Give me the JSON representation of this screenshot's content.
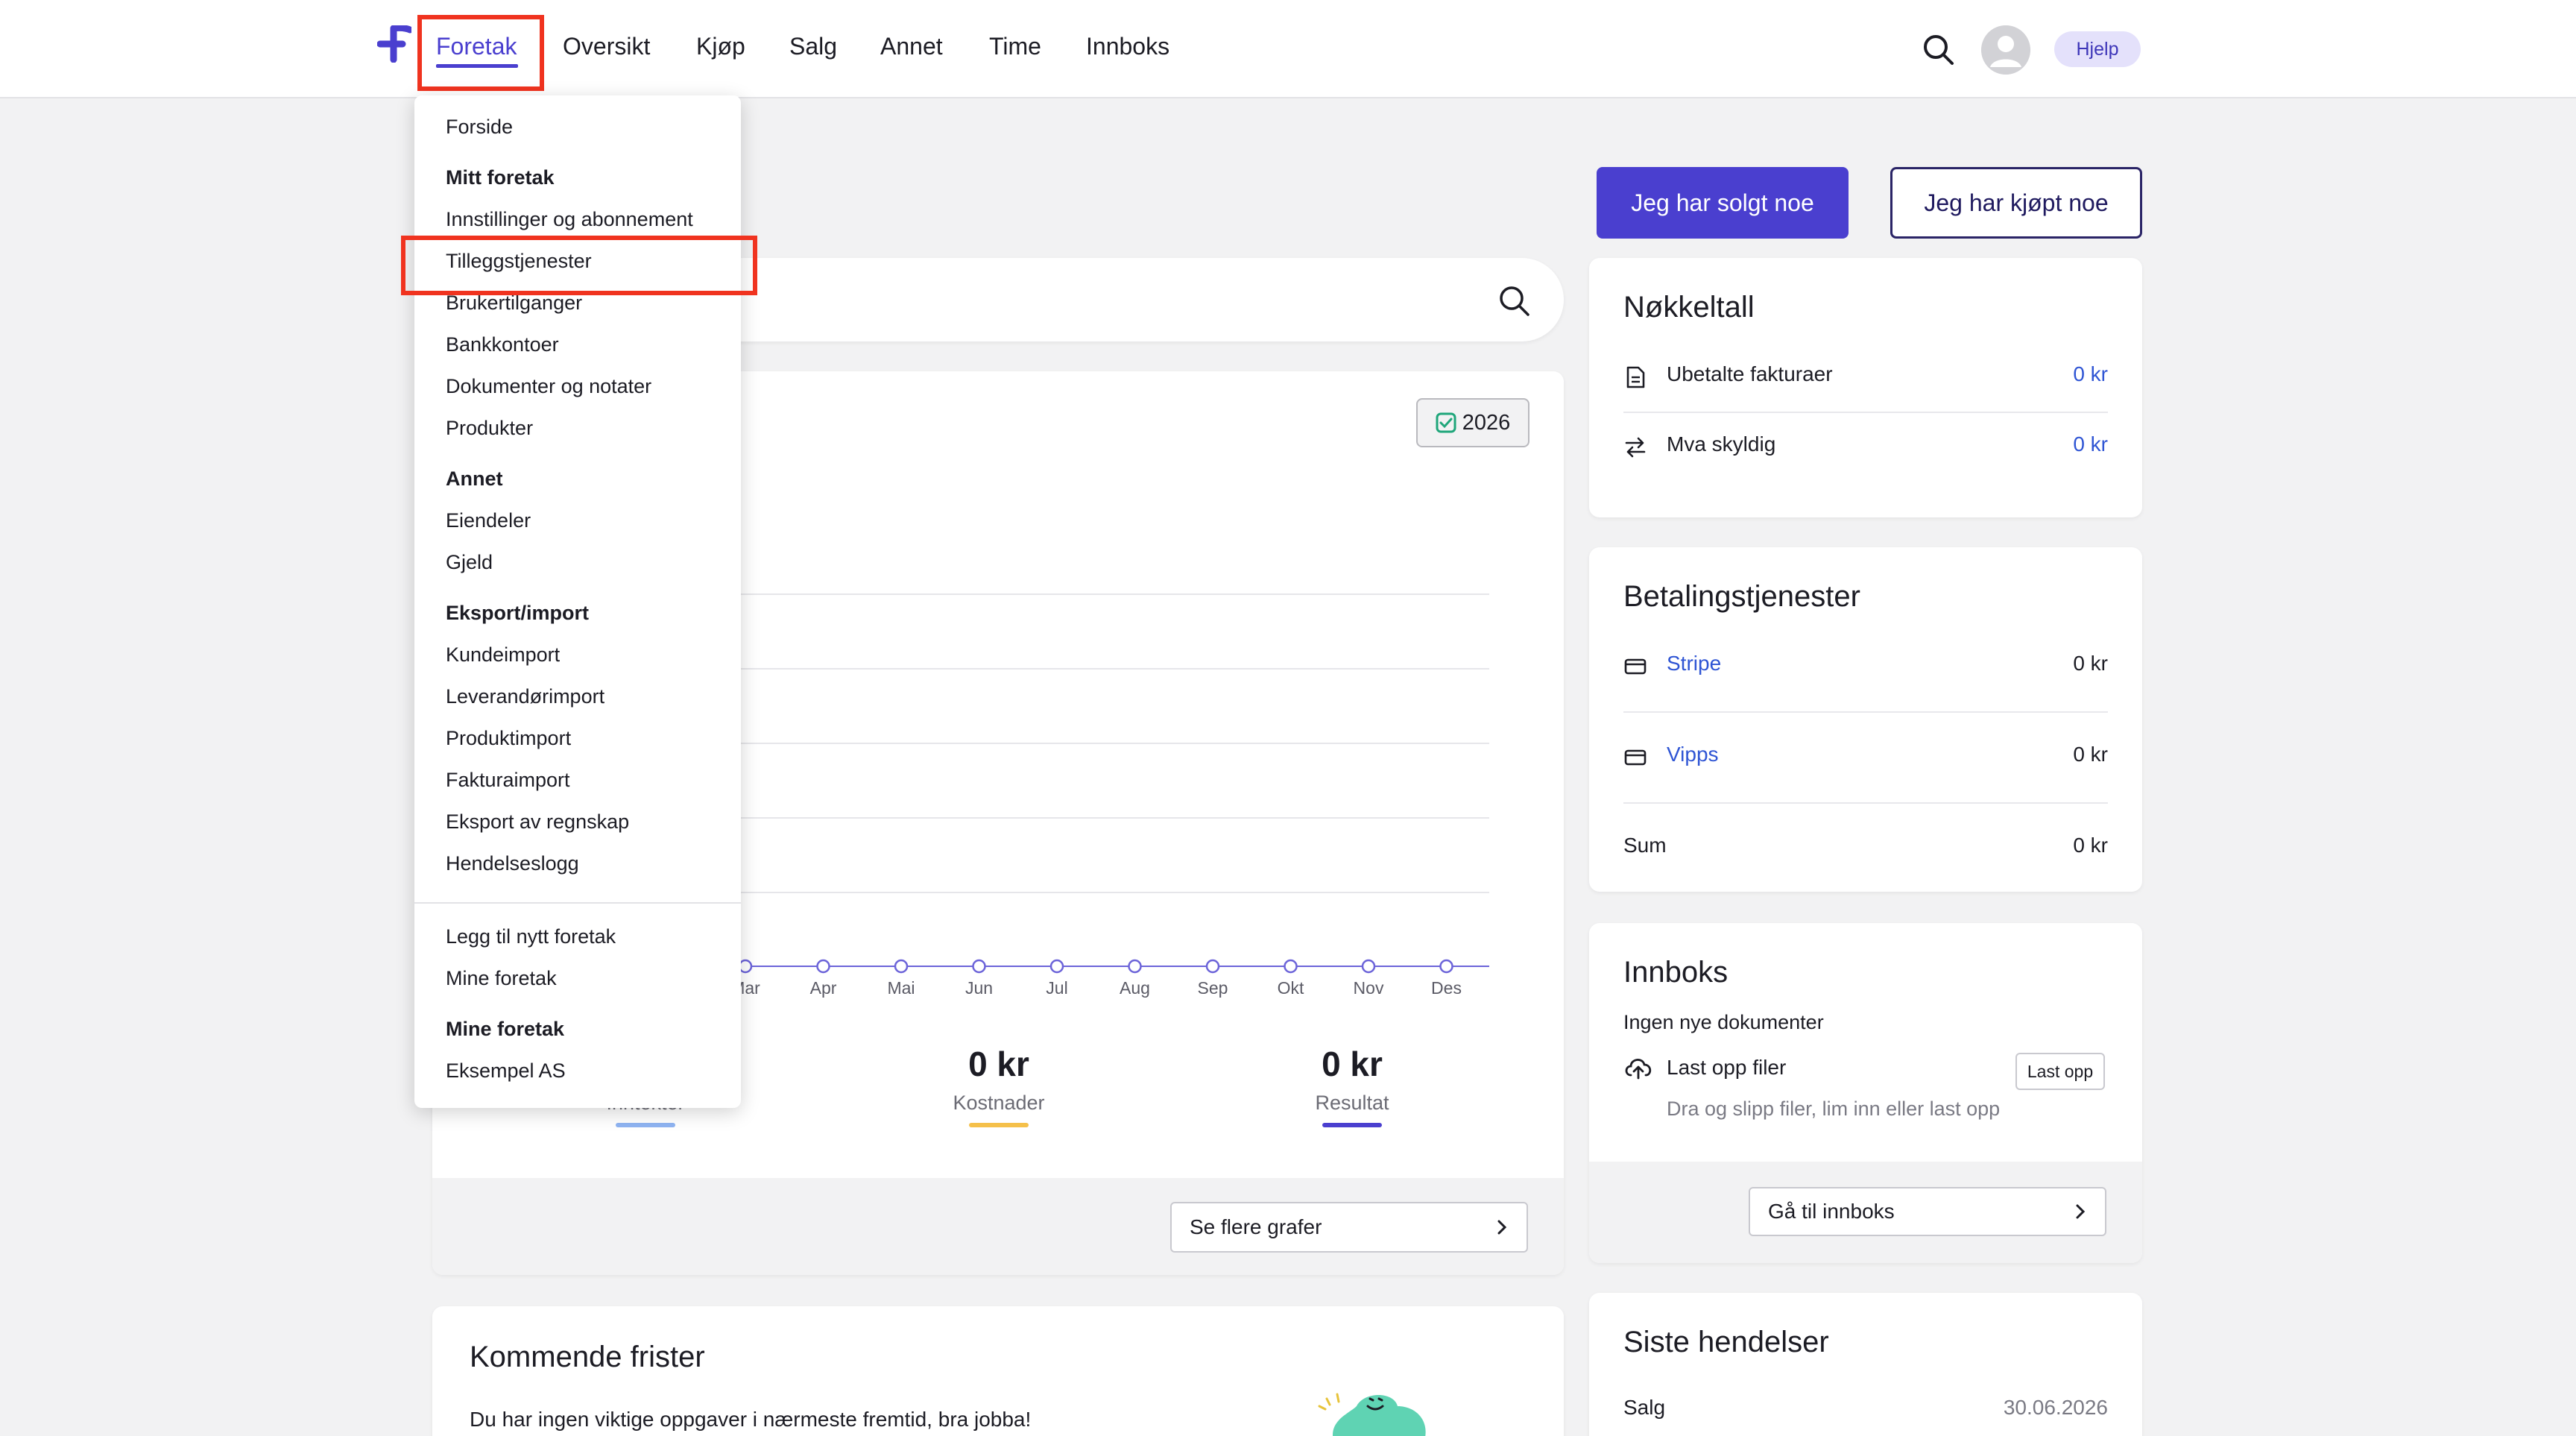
{
  "nav": {
    "items": [
      {
        "label": "Foretak"
      },
      {
        "label": "Oversikt"
      },
      {
        "label": "Kjøp"
      },
      {
        "label": "Salg"
      },
      {
        "label": "Annet"
      },
      {
        "label": "Time"
      },
      {
        "label": "Innboks"
      }
    ],
    "help_label": "Hjelp"
  },
  "actions": {
    "sold_label": "Jeg har solgt noe",
    "bought_label": "Jeg har kjøpt noe"
  },
  "dropdown": {
    "forside": "Forside",
    "mitt_foretak_head": "Mitt foretak",
    "innstillinger": "Innstillinger og abonnement",
    "tilleggstjenester": "Tilleggstjenester",
    "brukertilganger": "Brukertilganger",
    "bankkontoer": "Bankkontoer",
    "dokumenter": "Dokumenter og notater",
    "produkter": "Produkter",
    "annet_head": "Annet",
    "eiendeler": "Eiendeler",
    "gjeld": "Gjeld",
    "eksport_head": "Eksport/import",
    "kundeimport": "Kundeimport",
    "leverandorimport": "Leverandørimport",
    "produktimport": "Produktimport",
    "fakturaimport": "Fakturaimport",
    "eksport_regnskap": "Eksport av regnskap",
    "hendelseslogg": "Hendelseslogg",
    "legg_til": "Legg til nytt foretak",
    "mine_foretak": "Mine foretak",
    "mine_foretak_head": "Mine foretak",
    "eksempel": "Eksempel AS"
  },
  "overview": {
    "year_badge": "2026",
    "months": [
      "Mar",
      "Apr",
      "Mai",
      "Jun",
      "Jul",
      "Aug",
      "Sep",
      "Okt",
      "Nov",
      "Des"
    ],
    "stats": [
      {
        "value": "",
        "label": "Inntekter",
        "color": "#8fb4f2"
      },
      {
        "value": "0 kr",
        "label": "Kostnader",
        "color": "#f5c04a"
      },
      {
        "value": "0 kr",
        "label": "Resultat",
        "color": "#4a3fcf"
      }
    ],
    "more_graphs": "Se flere grafer"
  },
  "chart_data": {
    "type": "line",
    "categories": [
      "Mar",
      "Apr",
      "Mai",
      "Jun",
      "Jul",
      "Aug",
      "Sep",
      "Okt",
      "Nov",
      "Des"
    ],
    "series": [
      {
        "values": [
          0,
          0,
          0,
          0,
          0,
          0,
          0,
          0,
          0,
          0
        ]
      }
    ],
    "title": "",
    "xlabel": "",
    "ylabel": "",
    "grid": true
  },
  "kpi": {
    "title": "Nøkkeltall",
    "rows": [
      {
        "label": "Ubetalte fakturaer",
        "value": "0 kr"
      },
      {
        "label": "Mva skyldig",
        "value": "0 kr"
      }
    ]
  },
  "payments": {
    "title": "Betalingstjenester",
    "rows": [
      {
        "label": "Stripe",
        "value": "0 kr"
      },
      {
        "label": "Vipps",
        "value": "0 kr"
      }
    ],
    "sum_label": "Sum",
    "sum_value": "0 kr"
  },
  "inbox": {
    "title": "Innboks",
    "empty_text": "Ingen nye dokumenter",
    "upload_label": "Last opp filer",
    "upload_button": "Last opp",
    "drop_hint": "Dra og slipp filer, lim inn eller last opp",
    "goto_label": "Gå til innboks"
  },
  "deadlines": {
    "title": "Kommende frister",
    "text": "Du har ingen viktige oppgaver i nærmeste fremtid, bra jobba!"
  },
  "events": {
    "title": "Siste hendelser",
    "rows": [
      {
        "label": "Salg",
        "date": "30.06.2026"
      }
    ]
  }
}
